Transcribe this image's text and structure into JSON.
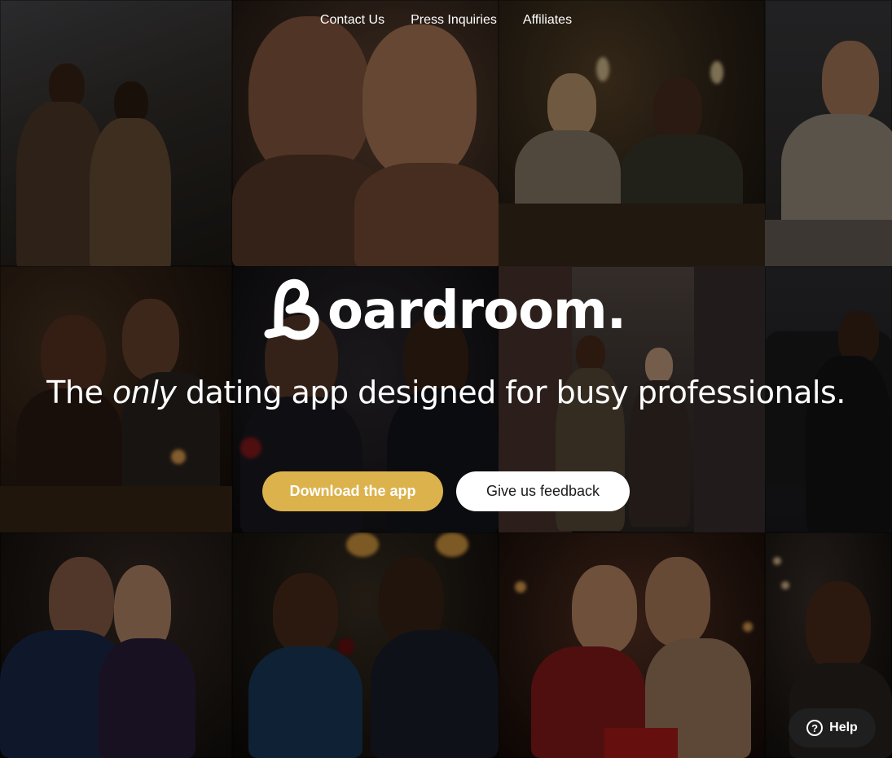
{
  "nav": {
    "links": [
      "Contact Us",
      "Press Inquiries",
      "Affiliates"
    ]
  },
  "brand": {
    "name": "Boardroom.",
    "logo_rest": "oardroom."
  },
  "hero": {
    "tagline_before": "The ",
    "tagline_emphasis": "only",
    "tagline_after": " dating app designed for busy professionals.",
    "primary_button": "Download the app",
    "secondary_button": "Give us feedback"
  },
  "help": {
    "label": "Help",
    "icon": "question-circle-icon"
  },
  "colors": {
    "accent": "#dcb24c",
    "button_light": "#ffffff",
    "help_bg": "#1f1f1f"
  },
  "background_photos": [
    "couple-bridge-photo",
    "couple-laughing-photo",
    "couple-restaurant-toast-photo",
    "man-smiling-dinner-photo",
    "couple-candlelit-dinner-photo",
    "woman-date-night-photo",
    "couple-city-street-photo",
    "man-by-car-photo",
    "couple-embrace-photo",
    "couple-rose-photo",
    "couple-gift-photo",
    "woman-city-lights-photo"
  ]
}
